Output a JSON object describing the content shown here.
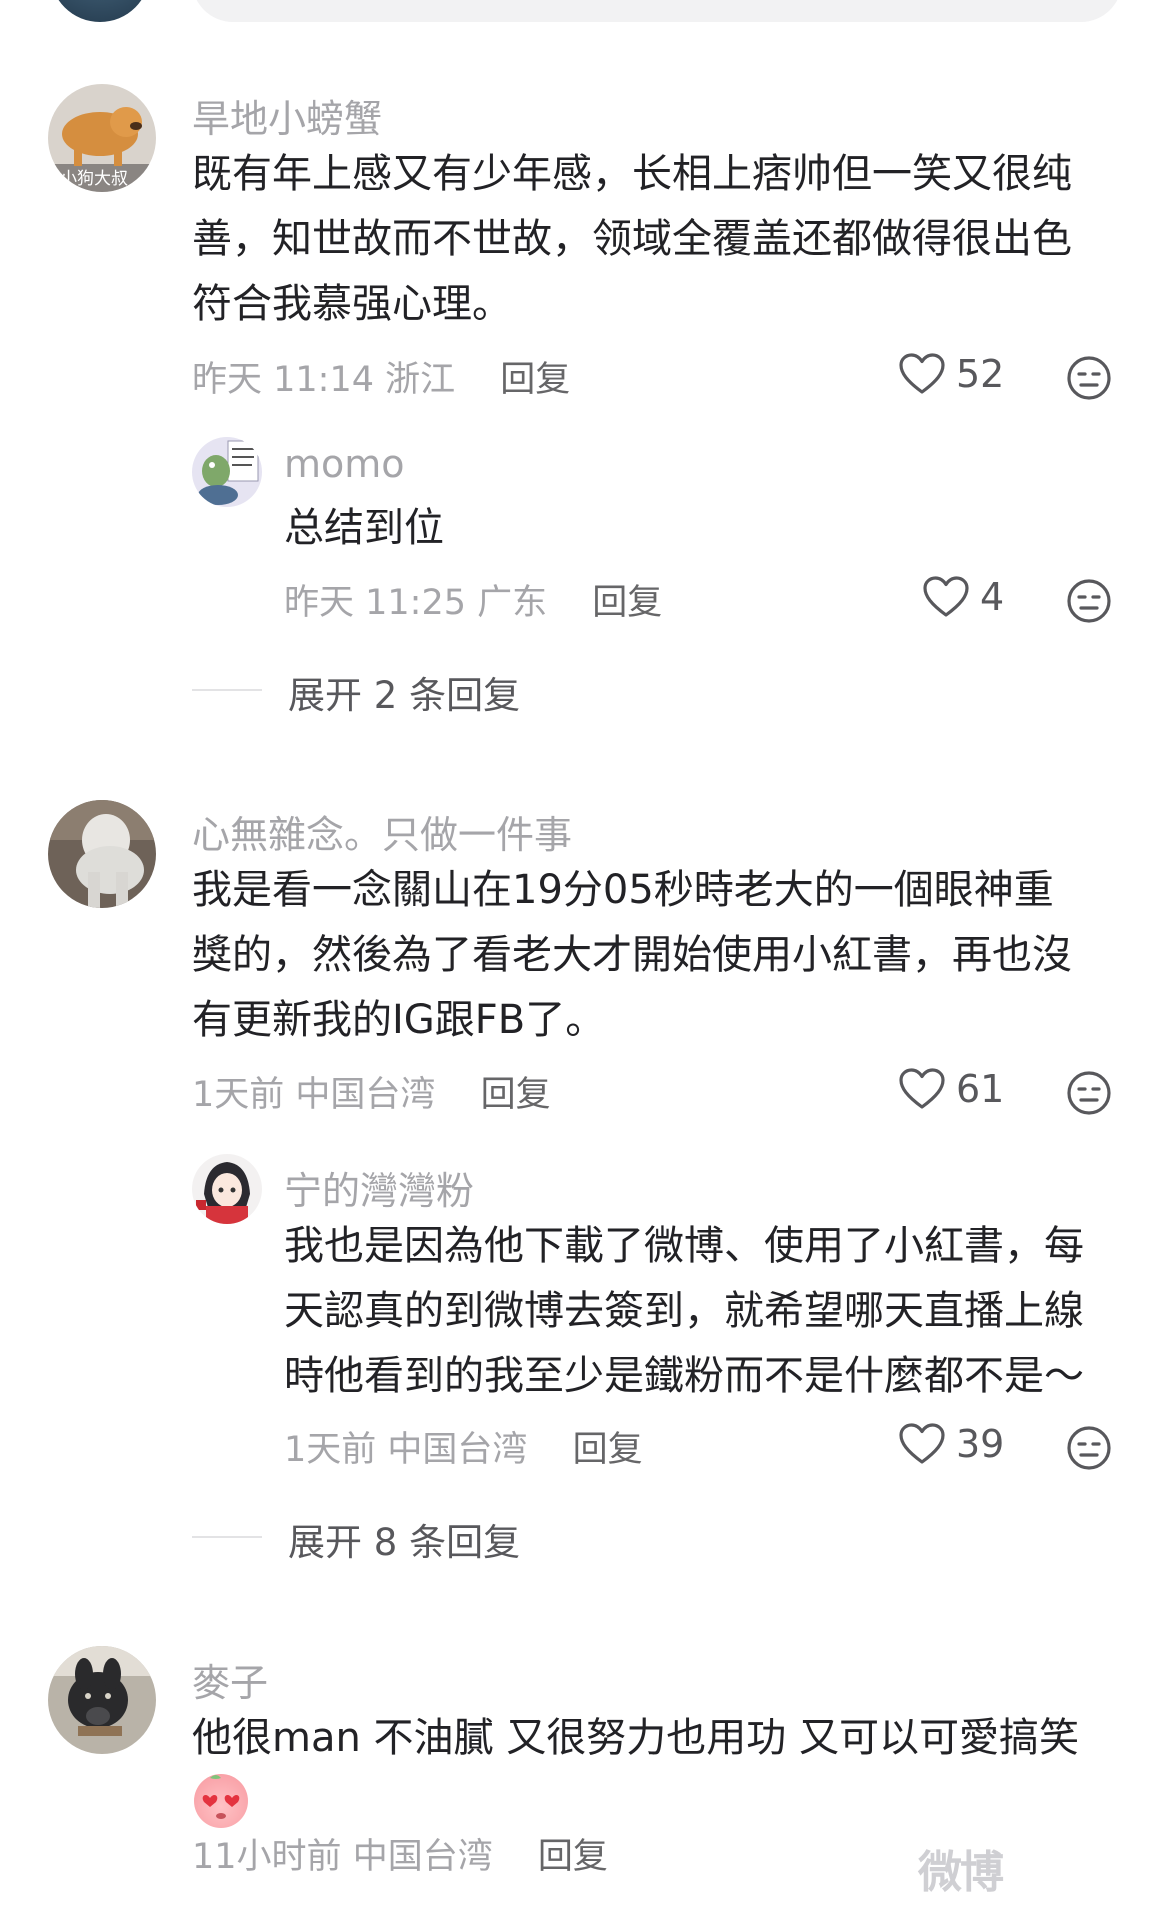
{
  "comments": [
    {
      "username": "旱地小螃蟹",
      "avatar_caption": "小狗大叔",
      "text": "既有年上感又有少年感，长相上痞帅但一笑又很纯\n善，知世故而不世故，领域全覆盖还都做得很出色\n符合我慕强心理。",
      "time": "昨天 11:14",
      "location": "浙江",
      "reply_label": "回复",
      "likes": "52",
      "replies": [
        {
          "username": "momo",
          "text": "总结到位",
          "time": "昨天 11:25",
          "location": "广东",
          "reply_label": "回复",
          "likes": "4"
        }
      ],
      "expand_label": "展开 2 条回复"
    },
    {
      "username": "心無雜念。只做一件事",
      "text": "我是看一念關山在19分05秒時老大的一個眼神重\n獎的，然後為了看老大才開始使用小紅書，再也沒\n有更新我的IG跟FB了。",
      "time": "1天前",
      "location": "中国台湾",
      "reply_label": "回复",
      "likes": "61",
      "replies": [
        {
          "username": "宁的灣灣粉",
          "text": "我也是因為他下載了微博、使用了小紅書，每\n天認真的到微博去簽到，就希望哪天直播上線\n時他看到的我至少是鐵粉而不是什麼都不是～",
          "time": "1天前",
          "location": "中国台湾",
          "reply_label": "回复",
          "likes": "39"
        }
      ],
      "expand_label": "展开 8 条回复"
    },
    {
      "username": "麥子",
      "text": "他很man 不油膩 又很努力也用功 又可以可愛搞笑",
      "time": "11小时前",
      "location": "中国台湾",
      "reply_label": "回复"
    }
  ],
  "icons": {
    "like": "heart-outline-icon",
    "dislike": "neutral-face-icon"
  },
  "watermark_text": "微博",
  "colors": {
    "text": "#222226",
    "meta": "#a5a5a9",
    "action": "#58585c"
  }
}
